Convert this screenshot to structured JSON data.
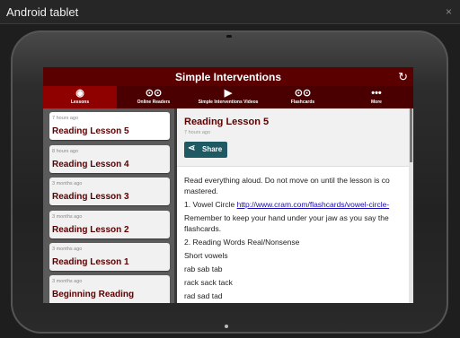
{
  "window": {
    "title": "Android tablet",
    "close_glyph": "×"
  },
  "app": {
    "title": "Simple Interventions",
    "tabs": [
      {
        "label": "Lessons",
        "icon": "rss-icon",
        "glyph": "◉"
      },
      {
        "label": "Online Readers",
        "icon": "link-icon",
        "glyph": "⊙⊙"
      },
      {
        "label": "Simple Interventions Videos",
        "icon": "video-icon",
        "glyph": "▶"
      },
      {
        "label": "Flashcards",
        "icon": "link-icon",
        "glyph": "⊙⊙"
      },
      {
        "label": "More",
        "icon": "more-dots-icon",
        "glyph": "•••"
      }
    ],
    "lessons": [
      {
        "time": "7 hours ago",
        "title": "Reading Lesson 5"
      },
      {
        "time": "8 hours ago",
        "title": "Reading Lesson 4"
      },
      {
        "time": "3 months ago",
        "title": "Reading Lesson 3"
      },
      {
        "time": "3 months ago",
        "title": "Reading Lesson 2"
      },
      {
        "time": "3 months ago",
        "title": "Reading Lesson 1"
      },
      {
        "time": "3 months ago",
        "title": "Beginning Reading"
      }
    ],
    "detail": {
      "title": "Reading Lesson 5",
      "time": "7 hours ago",
      "share_label": "Share",
      "lines": [
        "Read everything aloud. Do not move on until the lesson is co",
        "mastered.",
        "1. Vowel Circle ",
        "Remember to keep your hand under your jaw as you say the",
        "flashcards.",
        "2. Reading Words Real/Nonsense",
        "Short vowels",
        "rab sab tab",
        "rack sack tack",
        "rad sad tad"
      ],
      "link": "http://www.cram.com/flashcards/vowel-circle-"
    }
  },
  "colors": {
    "appbar": "#5a0000",
    "tab_active": "#8f0000",
    "share": "#1f5a64"
  }
}
